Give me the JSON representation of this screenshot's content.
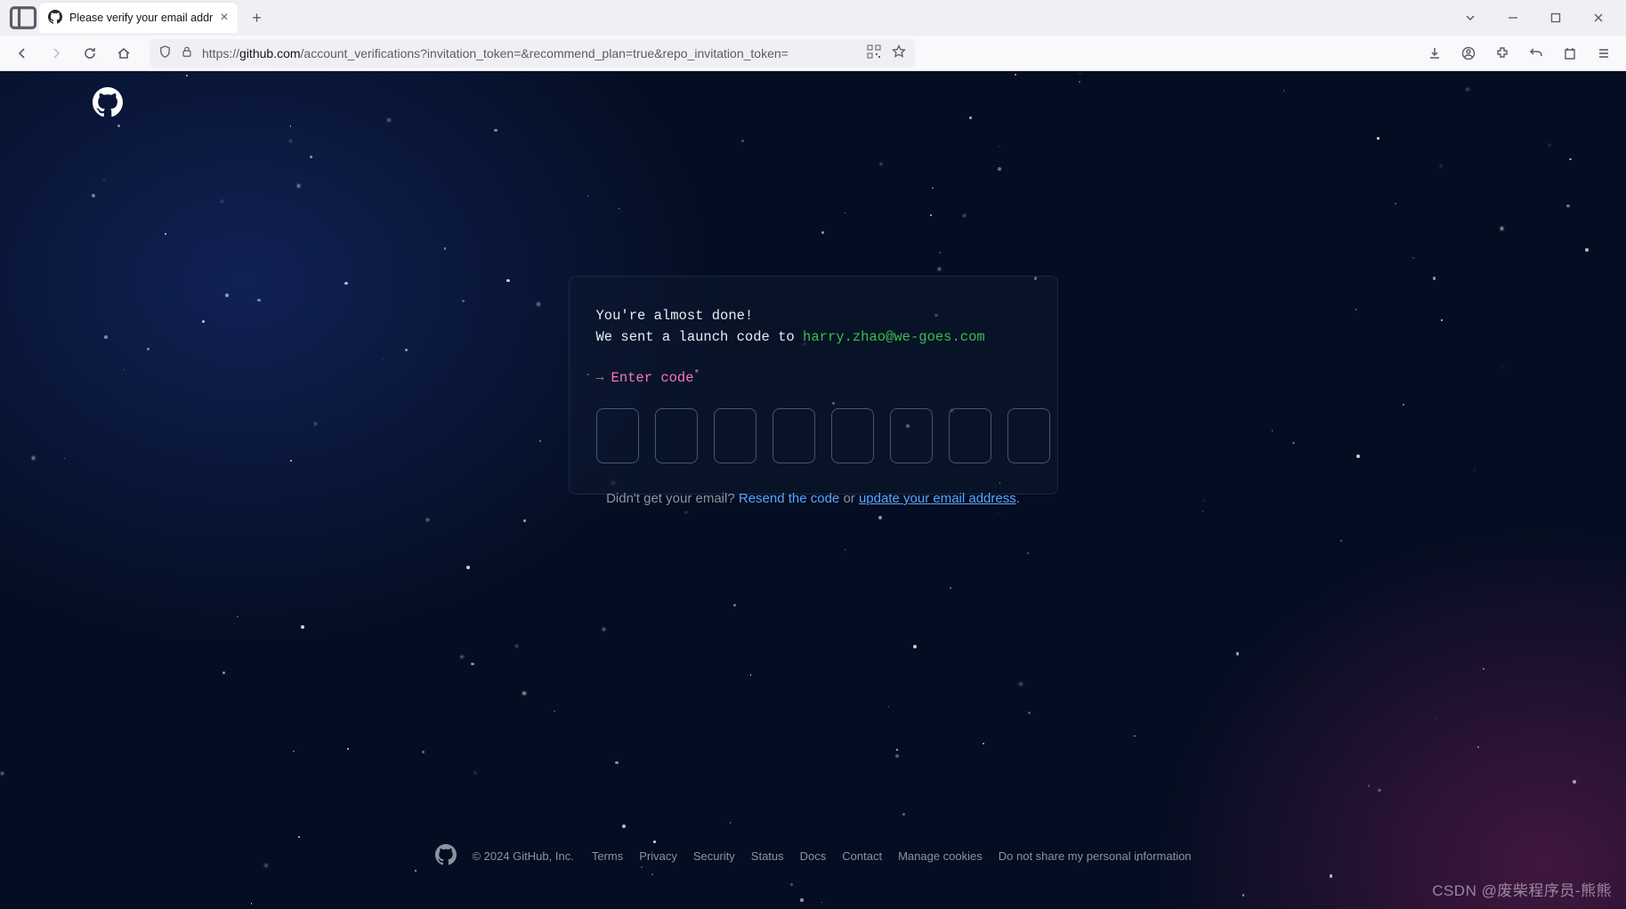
{
  "browser": {
    "tab_title": "Please verify your email addr",
    "url_prefix": "https://",
    "url_domain": "github.com",
    "url_path": "/account_verifications?invitation_token=&recommend_plan=true&repo_invitation_token="
  },
  "card": {
    "line1": "You're almost done!",
    "line2_prefix": "We sent a launch code to ",
    "email": "harry.zhao@we-goes.com",
    "prompt_arrow": "→",
    "prompt_label": "Enter code",
    "asterisk": "*",
    "code_length": 8
  },
  "under": {
    "prefix": "Didn't get your email? ",
    "resend": "Resend the code",
    "middle": " or ",
    "update": "update your email address",
    "suffix": "."
  },
  "footer": {
    "copyright": "© 2024 GitHub, Inc.",
    "links": [
      "Terms",
      "Privacy",
      "Security",
      "Status",
      "Docs",
      "Contact",
      "Manage cookies",
      "Do not share my personal information"
    ]
  },
  "watermark": "CSDN @废柴程序员-熊熊"
}
